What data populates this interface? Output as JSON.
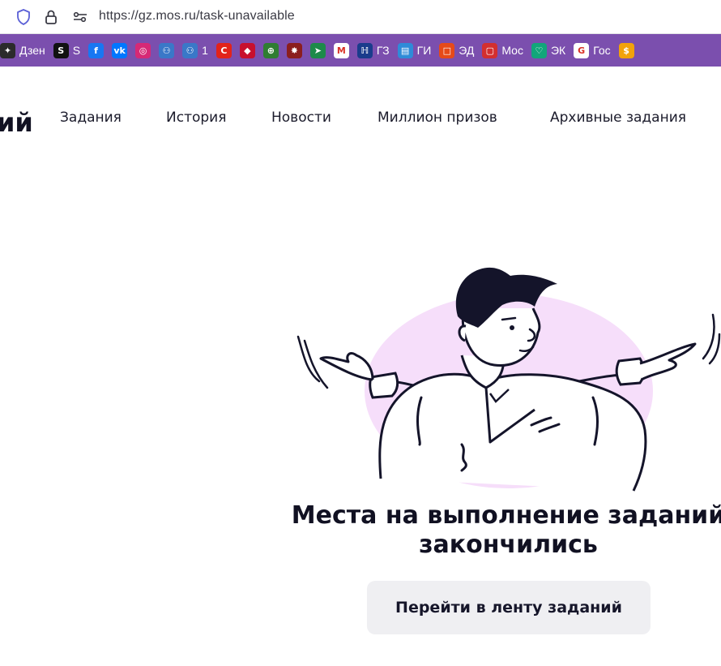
{
  "browser": {
    "url": "https://gz.mos.ru/task-unavailable",
    "icons": [
      "shield-icon",
      "lock-icon",
      "tune-icon"
    ],
    "bookmarks": [
      {
        "label": "Дзен",
        "icon": "sparkle-icon",
        "bg": "#2b2b2b",
        "glyph": "✦"
      },
      {
        "label": "S",
        "icon": "s-logo-icon",
        "bg": "#111111",
        "glyph": "S"
      },
      {
        "label": "",
        "icon": "facebook-icon",
        "bg": "#1877f2",
        "glyph": "f"
      },
      {
        "label": "",
        "icon": "vk-icon",
        "bg": "#0077ff",
        "glyph": "vk"
      },
      {
        "label": "",
        "icon": "instagram-icon",
        "bg": "#d62976",
        "glyph": "◎"
      },
      {
        "label": "",
        "icon": "people-icon",
        "bg": "#3a78c8",
        "glyph": "⚇"
      },
      {
        "label": "1",
        "icon": "people-icon",
        "bg": "#3a78c8",
        "glyph": "⚇"
      },
      {
        "label": "",
        "icon": "red-swirl-icon",
        "bg": "#e2231a",
        "glyph": "C"
      },
      {
        "label": "",
        "icon": "spartak-icon",
        "bg": "#c8102e",
        "glyph": "◆"
      },
      {
        "label": "",
        "icon": "target-icon",
        "bg": "#2f7d32",
        "glyph": "⊕"
      },
      {
        "label": "",
        "icon": "game-icon",
        "bg": "#8b1e1e",
        "glyph": "✸"
      },
      {
        "label": "",
        "icon": "arrow-green-icon",
        "bg": "#1d8a4a",
        "glyph": "➤"
      },
      {
        "label": "",
        "icon": "gmail-icon",
        "bg": "#ffffff",
        "glyph": "M"
      },
      {
        "label": "ГЗ",
        "icon": "gz-logo-icon",
        "bg": "#1a3c8c",
        "glyph": "ℍ"
      },
      {
        "label": "ГИ",
        "icon": "chat-icon",
        "bg": "#2f8bd8",
        "glyph": "▤"
      },
      {
        "label": "ЭД",
        "icon": "tv-icon",
        "bg": "#e64a19",
        "glyph": "□"
      },
      {
        "label": "Мос",
        "icon": "mos-icon",
        "bg": "#d32f2f",
        "glyph": "▢"
      },
      {
        "label": "ЭК",
        "icon": "heart-shield-icon",
        "bg": "#12a67a",
        "glyph": "♡"
      },
      {
        "label": "Гос",
        "icon": "gosuslugi-icon",
        "bg": "#ffffff",
        "glyph": "G"
      },
      {
        "label": "",
        "icon": "coin-icon",
        "bg": "#f2a20a",
        "glyph": "$"
      }
    ]
  },
  "site": {
    "brand_fragment": "ий",
    "nav": [
      {
        "label": "Задания"
      },
      {
        "label": "История"
      },
      {
        "label": "Новости"
      },
      {
        "label": "Миллион призов"
      },
      {
        "label": "Архивные задания"
      }
    ]
  },
  "main": {
    "message_line1": "Места на выполнение заданий",
    "message_line2": "закончились",
    "cta_label": "Перейти в ленту заданий"
  },
  "colors": {
    "bookmarks_bar": "#7b4fae",
    "blob": "#f6defa",
    "button_bg": "#efeff2",
    "text_dark": "#111122"
  }
}
